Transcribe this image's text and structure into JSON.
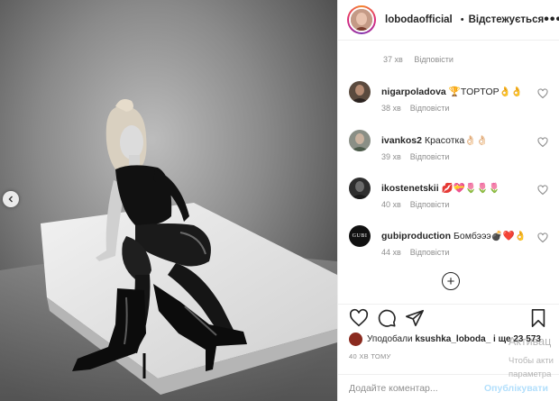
{
  "header": {
    "username": "lobodaofficial",
    "separator": "•",
    "follow_state": "Відстежується",
    "more": "•••"
  },
  "first_meta": {
    "time": "37 хв",
    "reply": "Відповісти"
  },
  "comments": [
    {
      "username": "nigarpoladova",
      "text": "🏆TOPTOP👌👌",
      "time": "38 хв",
      "reply": "Відповісти"
    },
    {
      "username": "ivankos2",
      "text": "Красотка👌🏻👌🏻",
      "time": "39 хв",
      "reply": "Відповісти"
    },
    {
      "username": "ikostenetskii",
      "text": "💋💝🌷🌷🌷",
      "time": "40 хв",
      "reply": "Відповісти"
    },
    {
      "username": "gubiproduction",
      "text": "Бомбэээ💣❤️👌",
      "time": "44 хв",
      "reply": "Відповісти",
      "avatar_text": "GUBI"
    }
  ],
  "load_more": "+",
  "icons": [
    "heart-icon",
    "comment-icon",
    "share-icon",
    "bookmark-icon"
  ],
  "likes": {
    "prefix": "Уподобали",
    "user": "ksushka_loboda_",
    "suffix": "і ще 23 573"
  },
  "timestamp": "40 ХВ ТОМУ",
  "add_comment": {
    "placeholder": "Додайте коментар...",
    "publish": "Опублікувати"
  },
  "windows_overlay": {
    "title": "Активац",
    "line1": "Чтобы акти",
    "line2": "параметра"
  },
  "colors": {
    "accent": "#0095f6",
    "publish_disabled": "#b2dffc",
    "verified": "#3897f0"
  }
}
